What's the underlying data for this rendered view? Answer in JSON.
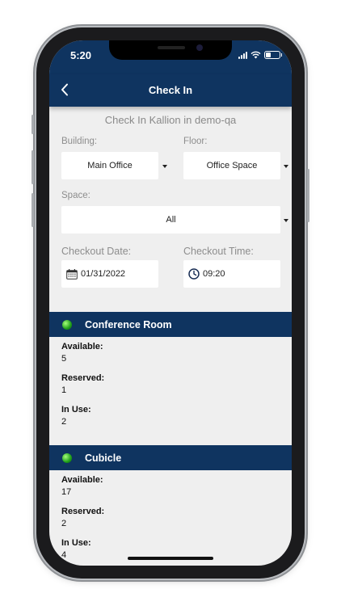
{
  "status_bar": {
    "time": "5:20"
  },
  "nav": {
    "title": "Check In",
    "back_icon": "chevron-left-icon"
  },
  "subtitle": "Check In Kallion in demo-qa",
  "filters": {
    "building": {
      "label": "Building:",
      "value": "Main Office"
    },
    "floor": {
      "label": "Floor:",
      "value": "Office Space"
    },
    "space": {
      "label": "Space:",
      "value": "All"
    },
    "checkout_date": {
      "label": "Checkout Date:",
      "value": "01/31/2022",
      "icon": "calendar-icon"
    },
    "checkout_time": {
      "label": "Checkout Time:",
      "value": "09:20",
      "icon": "clock-icon"
    }
  },
  "sections": [
    {
      "title": "Conference Room",
      "status_color": "#2bb526",
      "available_label": "Available:",
      "available": "5",
      "reserved_label": "Reserved:",
      "reserved": "1",
      "in_use_label": "In Use:",
      "in_use": "2"
    },
    {
      "title": "Cubicle",
      "status_color": "#2bb526",
      "available_label": "Available:",
      "available": "17",
      "reserved_label": "Reserved:",
      "reserved": "2",
      "in_use_label": "In Use:",
      "in_use": "4"
    }
  ],
  "colors": {
    "brand": "#0f3460",
    "background": "#efefef"
  }
}
